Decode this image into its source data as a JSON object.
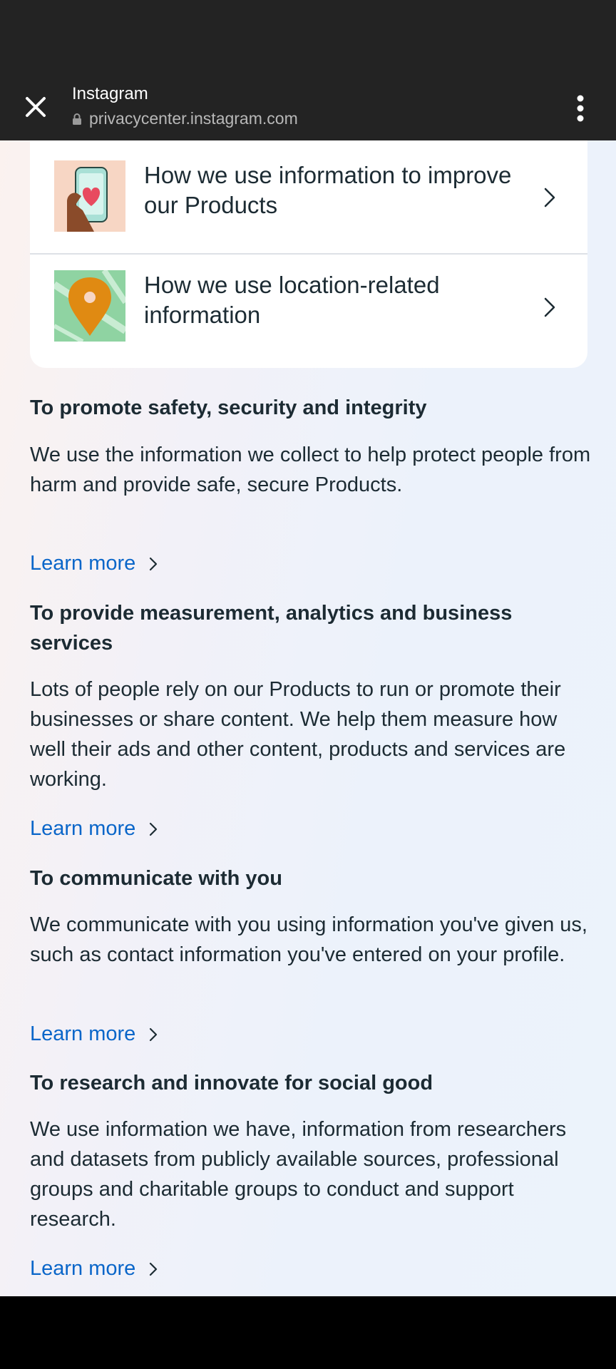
{
  "toolbar": {
    "title": "Instagram",
    "url": "privacycenter.instagram.com"
  },
  "card": {
    "rows": [
      {
        "label": "How we use information to improve our Products",
        "icon": "phone-heart-illustration"
      },
      {
        "label": "How we use location-related information",
        "icon": "map-pin-illustration"
      }
    ]
  },
  "sections": [
    {
      "heading": "To promote safety, security and integrity",
      "body": "We use the information we collect to help protect people from harm and provide safe, secure Products.",
      "link": "Learn more"
    },
    {
      "heading": "To provide measurement, analytics and business services",
      "body": "Lots of people rely on our Products to run or promote their businesses or share content. We help them measure how well their ads and other content, products and services are working.",
      "link": "Learn more"
    },
    {
      "heading": "To communicate with you",
      "body": "We communicate with you using information you've given us, such as contact information you've entered on your profile.",
      "link": "Learn more"
    },
    {
      "heading": "To research and innovate for social good",
      "body": "We use information we have, information from researchers and datasets from publicly available sources, professional groups and charitable groups to conduct and support research.",
      "link": "Learn more"
    }
  ],
  "colors": {
    "link": "#0a66c9",
    "text": "#1c2b33",
    "toolbar": "#232323"
  }
}
